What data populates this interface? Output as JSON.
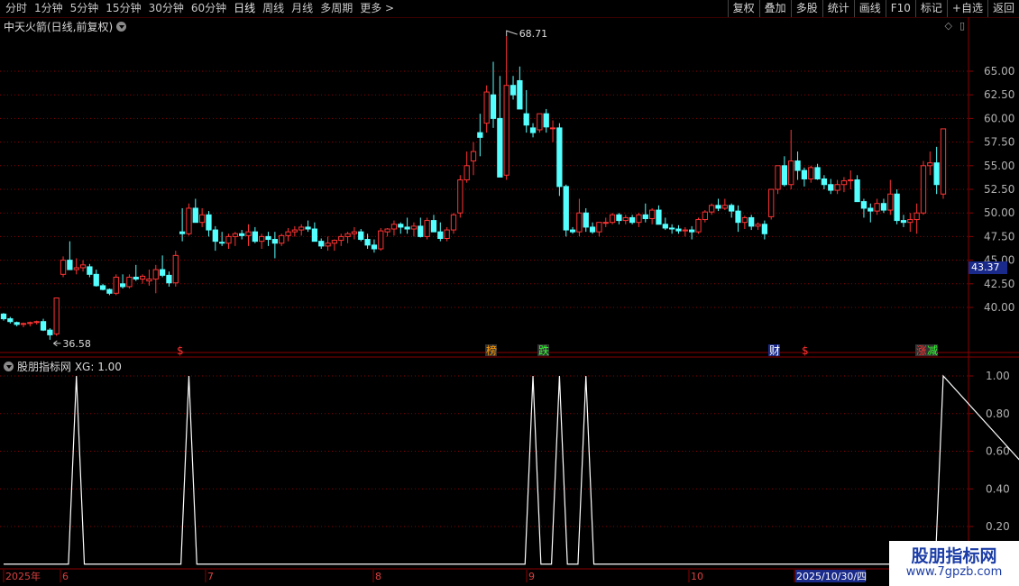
{
  "toolbar": {
    "periods": [
      "分时",
      "1分钟",
      "5分钟",
      "15分钟",
      "30分钟",
      "60分钟",
      "日线",
      "周线",
      "月线",
      "多周期",
      "更多 >"
    ],
    "active": "日线",
    "actions": [
      "复权",
      "叠加",
      "多股",
      "统计",
      "画线",
      "F10",
      "标记",
      "+自选",
      "返回"
    ]
  },
  "main_title": "中天火箭(日线,前复权)",
  "indicator_title": "股朋指标网 XG: 1.00",
  "current_price_tag": "43.37",
  "high_label": "68.71",
  "low_label": "36.58",
  "event_markers": [
    {
      "text": "$",
      "color": "#ff3030"
    },
    {
      "text": "榜",
      "color": "#ff9900",
      "bg": "#333"
    },
    {
      "text": "跌",
      "color": "#30ff30",
      "bg": "#333"
    },
    {
      "text": "财",
      "color": "#ffffff",
      "bg": "#1a2a8a"
    },
    {
      "text": "$",
      "color": "#ff3030"
    },
    {
      "text": "涨",
      "color": "#ff3030",
      "bg": "#333"
    },
    {
      "text": "减",
      "color": "#30ff30",
      "bg": "#333"
    }
  ],
  "time_axis": [
    "2025年",
    "6",
    "7",
    "8",
    "9",
    "10",
    "2025/10/30/四"
  ],
  "watermark": {
    "title": "股朋指标网",
    "url": "www.7gpzb.com"
  },
  "colors": {
    "up": "#ff3333",
    "down": "#54ffff",
    "grid": "#8b0000",
    "bg": "#000000"
  },
  "chart_data": [
    {
      "type": "candlestick",
      "title": "中天火箭(日线,前复权)",
      "y_ticks": [
        40.0,
        42.5,
        45.0,
        47.5,
        50.0,
        52.5,
        55.0,
        57.5,
        60.0,
        62.5,
        65.0
      ],
      "ylim": [
        35.2,
        70.6
      ],
      "max": 68.71,
      "min": 36.58,
      "ohlc": [
        [
          39.3,
          39.4,
          38.6,
          38.8
        ],
        [
          38.8,
          39.0,
          38.3,
          38.5
        ],
        [
          38.4,
          38.5,
          38.0,
          38.2
        ],
        [
          38.2,
          38.4,
          37.9,
          38.3
        ],
        [
          38.3,
          38.5,
          38.0,
          38.4
        ],
        [
          38.4,
          38.6,
          38.2,
          38.5
        ],
        [
          38.5,
          38.8,
          37.5,
          37.6
        ],
        [
          37.6,
          37.8,
          36.58,
          37.1
        ],
        [
          37.2,
          41.0,
          37.0,
          41.0
        ],
        [
          43.5,
          45.4,
          43.2,
          45.0
        ],
        [
          45.0,
          47.0,
          44.5,
          44.0
        ],
        [
          44.0,
          45.2,
          43.5,
          44.2
        ],
        [
          44.2,
          45.0,
          43.8,
          44.5
        ],
        [
          44.3,
          44.6,
          43.2,
          43.5
        ],
        [
          43.5,
          44.0,
          42.2,
          42.3
        ],
        [
          42.3,
          42.5,
          41.8,
          41.9
        ],
        [
          41.9,
          42.0,
          41.3,
          41.5
        ],
        [
          41.5,
          43.5,
          41.3,
          43.2
        ],
        [
          42.5,
          43.5,
          42.0,
          42.2
        ],
        [
          42.2,
          43.5,
          42.0,
          43.2
        ],
        [
          43.2,
          44.5,
          42.8,
          43.0
        ],
        [
          43.0,
          43.5,
          42.5,
          43.3
        ],
        [
          42.8,
          44.0,
          42.3,
          43.0
        ],
        [
          43.0,
          44.5,
          41.5,
          44.0
        ],
        [
          44.0,
          45.5,
          43.2,
          43.4
        ],
        [
          43.4,
          43.8,
          42.2,
          42.6
        ],
        [
          42.6,
          46.0,
          42.2,
          45.5
        ],
        [
          48.0,
          50.5,
          47.0,
          47.8
        ],
        [
          47.8,
          51.0,
          47.6,
          50.5
        ],
        [
          50.5,
          51.5,
          49.5,
          49.0
        ],
        [
          49.0,
          50.5,
          48.5,
          49.8
        ],
        [
          49.8,
          50.2,
          47.5,
          48.2
        ],
        [
          48.2,
          48.6,
          46.0,
          47.0
        ],
        [
          46.9,
          48.0,
          46.5,
          46.8
        ],
        [
          46.8,
          47.8,
          46.2,
          47.5
        ],
        [
          47.5,
          48.0,
          46.5,
          47.8
        ],
        [
          47.8,
          48.2,
          47.2,
          47.6
        ],
        [
          47.6,
          48.8,
          46.5,
          48.0
        ],
        [
          48.0,
          48.5,
          46.8,
          47.0
        ],
        [
          47.0,
          47.8,
          46.2,
          47.5
        ],
        [
          47.5,
          48.0,
          46.5,
          47.2
        ],
        [
          47.2,
          48.0,
          45.2,
          46.8
        ],
        [
          46.8,
          47.8,
          46.5,
          47.6
        ],
        [
          47.6,
          48.4,
          47.0,
          48.0
        ],
        [
          48.0,
          48.6,
          47.5,
          48.2
        ],
        [
          48.2,
          48.8,
          47.6,
          48.5
        ],
        [
          48.5,
          49.2,
          48.0,
          48.3
        ],
        [
          48.3,
          49.0,
          47.0,
          47.0
        ],
        [
          47.0,
          47.3,
          46.2,
          46.5
        ],
        [
          46.5,
          47.5,
          46.0,
          46.8
        ],
        [
          46.8,
          47.2,
          46.0,
          47.1
        ],
        [
          47.1,
          47.8,
          46.5,
          47.5
        ],
        [
          47.5,
          48.0,
          46.8,
          47.8
        ],
        [
          47.8,
          48.5,
          47.2,
          48.0
        ],
        [
          48.0,
          48.3,
          47.0,
          47.2
        ],
        [
          47.2,
          47.8,
          46.2,
          46.6
        ],
        [
          46.6,
          47.2,
          45.8,
          46.2
        ],
        [
          46.2,
          48.4,
          46.0,
          48.1
        ],
        [
          48.0,
          48.4,
          47.5,
          48.3
        ],
        [
          48.3,
          49.2,
          47.6,
          48.8
        ],
        [
          48.8,
          49.0,
          47.8,
          48.5
        ],
        [
          48.5,
          49.5,
          47.8,
          48.3
        ],
        [
          48.3,
          49.0,
          47.5,
          48.6
        ],
        [
          48.6,
          49.5,
          47.4,
          47.5
        ],
        [
          47.5,
          49.5,
          47.2,
          49.2
        ],
        [
          49.2,
          49.8,
          48.0,
          48.0
        ],
        [
          48.0,
          49.0,
          47.0,
          47.3
        ],
        [
          47.3,
          48.5,
          47.0,
          48.2
        ],
        [
          48.2,
          50.0,
          47.8,
          49.8
        ],
        [
          50.0,
          54.0,
          49.5,
          53.5
        ],
        [
          53.5,
          56.5,
          53.2,
          55.0
        ],
        [
          55.5,
          57.5,
          54.0,
          56.5
        ],
        [
          58.5,
          60.5,
          56.0,
          58.0
        ],
        [
          59.5,
          63.5,
          58.5,
          62.8
        ],
        [
          62.5,
          66.0,
          59.0,
          60.0
        ],
        [
          60.0,
          64.5,
          57.0,
          53.8
        ],
        [
          54.0,
          68.71,
          53.5,
          63.5
        ],
        [
          63.5,
          64.5,
          62.0,
          62.5
        ],
        [
          64.0,
          65.5,
          61.5,
          61.0
        ],
        [
          60.5,
          63.0,
          58.5,
          59.3
        ],
        [
          59.0,
          59.5,
          58.0,
          58.5
        ],
        [
          58.8,
          60.5,
          58.5,
          60.5
        ],
        [
          60.5,
          61.0,
          58.5,
          59.1
        ],
        [
          59.0,
          59.8,
          57.5,
          59.0
        ],
        [
          59.0,
          59.5,
          51.8,
          52.8
        ],
        [
          52.8,
          53.0,
          47.5,
          48.2
        ],
        [
          48.2,
          48.5,
          47.8,
          48.0
        ],
        [
          48.0,
          51.5,
          47.5,
          50.0
        ],
        [
          50.0,
          50.5,
          48.0,
          48.5
        ],
        [
          48.5,
          49.0,
          47.8,
          48.0
        ],
        [
          48.0,
          49.0,
          47.5,
          49.0
        ],
        [
          49.0,
          49.5,
          48.5,
          49.0
        ],
        [
          49.0,
          50.0,
          48.8,
          49.8
        ],
        [
          49.8,
          50.0,
          48.8,
          49.2
        ],
        [
          49.2,
          49.8,
          48.8,
          49.5
        ],
        [
          49.5,
          49.8,
          48.8,
          49.0
        ],
        [
          49.0,
          50.0,
          48.5,
          49.8
        ],
        [
          49.8,
          51.0,
          49.0,
          49.4
        ],
        [
          49.4,
          50.5,
          48.8,
          50.3
        ],
        [
          50.3,
          50.8,
          49.0,
          48.8
        ],
        [
          48.8,
          49.5,
          48.2,
          48.4
        ],
        [
          48.4,
          48.8,
          47.8,
          48.3
        ],
        [
          48.3,
          48.7,
          47.8,
          48.1
        ],
        [
          48.1,
          48.5,
          47.5,
          48.2
        ],
        [
          48.2,
          48.6,
          47.2,
          48.0
        ],
        [
          48.0,
          49.5,
          47.8,
          49.3
        ],
        [
          49.3,
          50.3,
          49.0,
          50.1
        ],
        [
          50.1,
          51.0,
          49.8,
          50.8
        ],
        [
          50.8,
          51.5,
          50.2,
          50.5
        ],
        [
          50.5,
          51.5,
          50.3,
          50.8
        ],
        [
          50.8,
          51.0,
          49.5,
          50.2
        ],
        [
          50.2,
          50.8,
          48.0,
          49.0
        ],
        [
          49.0,
          49.7,
          48.3,
          49.5
        ],
        [
          49.5,
          49.8,
          48.2,
          48.6
        ],
        [
          48.6,
          49.0,
          48.2,
          48.8
        ],
        [
          48.8,
          49.2,
          47.2,
          47.8
        ],
        [
          49.6,
          52.5,
          49.3,
          52.5
        ],
        [
          52.5,
          54.5,
          52.0,
          55.0
        ],
        [
          55.0,
          56.0,
          52.8,
          53.0
        ],
        [
          53.0,
          58.8,
          52.5,
          55.5
        ],
        [
          55.5,
          56.5,
          53.5,
          54.5
        ],
        [
          54.5,
          54.8,
          52.8,
          53.6
        ],
        [
          53.6,
          55.0,
          53.2,
          54.8
        ],
        [
          54.8,
          55.2,
          53.5,
          53.6
        ],
        [
          53.6,
          54.0,
          52.5,
          53.0
        ],
        [
          53.0,
          53.6,
          52.0,
          52.4
        ],
        [
          52.4,
          53.5,
          52.0,
          53.0
        ],
        [
          53.0,
          53.8,
          52.2,
          53.4
        ],
        [
          53.4,
          54.5,
          52.5,
          53.5
        ],
        [
          53.5,
          54.0,
          52.0,
          51.2
        ],
        [
          51.2,
          51.5,
          49.5,
          50.5
        ],
        [
          50.5,
          51.0,
          49.0,
          50.2
        ],
        [
          50.2,
          51.5,
          49.8,
          51.0
        ],
        [
          51.0,
          51.5,
          50.0,
          50.3
        ],
        [
          50.3,
          53.5,
          49.8,
          52.0
        ],
        [
          52.0,
          52.5,
          48.8,
          49.2
        ],
        [
          49.2,
          49.8,
          48.5,
          49.0
        ],
        [
          49.0,
          50.0,
          48.0,
          49.3
        ],
        [
          49.3,
          51.0,
          47.8,
          50.0
        ],
        [
          50.0,
          55.5,
          49.8,
          55.0
        ],
        [
          55.0,
          56.5,
          54.0,
          55.3
        ],
        [
          55.3,
          57.0,
          52.0,
          53.0
        ],
        [
          52.0,
          58.9,
          51.5,
          58.9
        ]
      ]
    },
    {
      "type": "line",
      "title": "股朋指标网 XG: 1.00",
      "series": [
        {
          "name": "XG",
          "spikes_at_index": [
            11,
            28,
            80,
            84,
            88,
            142,
            169
          ]
        }
      ],
      "y_ticks": [
        0.2,
        0.4,
        0.6,
        0.8,
        1.0
      ],
      "ylim": [
        -0.01,
        1.06
      ]
    }
  ]
}
